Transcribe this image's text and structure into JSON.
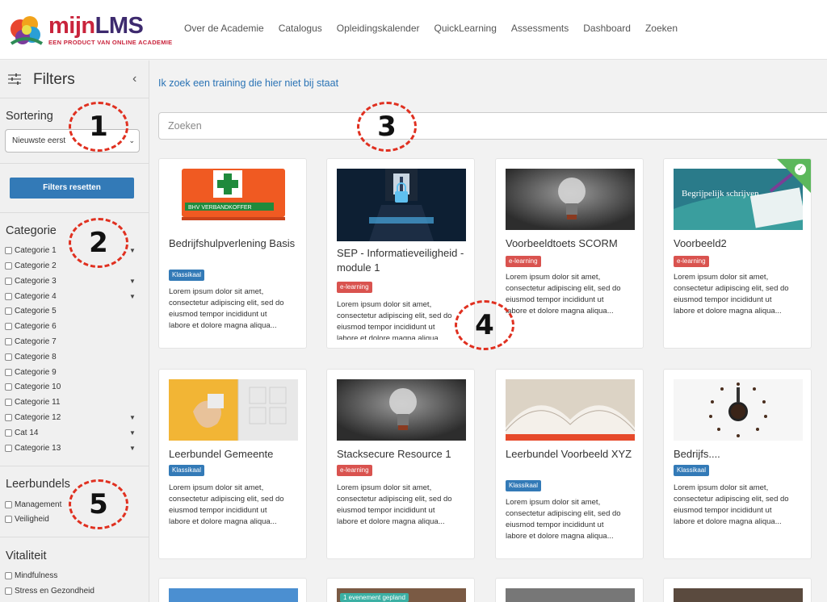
{
  "header": {
    "logo_main_a": "mijn",
    "logo_main_b": "LMS",
    "logo_tagline": "EEN PRODUCT VAN ONLINE ACADEMIE",
    "nav": [
      "Over de Academie",
      "Catalogus",
      "Opleidingskalender",
      "QuickLearning",
      "Assessments",
      "Dashboard",
      "Zoeken"
    ]
  },
  "sidebar": {
    "title": "Filters",
    "sorting_title": "Sortering",
    "sorting_value": "Nieuwste eerst",
    "reset_label": "Filters resetten",
    "category_title": "Categorie",
    "categories": [
      "Categorie 1",
      "Categorie 2",
      "Categorie 3",
      "Categorie 4",
      "Categorie 5",
      "Categorie 6",
      "Categorie 7",
      "Categorie 8",
      "Categorie 9",
      "Categorie 10",
      "Categorie 11",
      "Categorie 12",
      "Cat 14",
      "Categorie 13"
    ],
    "leerbundels_title": "Leerbundels",
    "leerbundels": [
      "Management",
      "Veiligheid"
    ],
    "vitaliteit_title": "Vitaliteit",
    "vitaliteit": [
      "Mindfulness",
      "Stress en Gezondheid"
    ]
  },
  "main": {
    "link": "Ik zoek een training die hier niet bij staat",
    "search_placeholder": "Zoeken",
    "lorem_1": "Lorem ipsum dolor sit amet,",
    "lorem_2": "consectetur adipiscing elit, sed do",
    "lorem_3": "eiusmod tempor incididunt ut",
    "lorem_4": "labore et dolore magna aliqua...",
    "cards": [
      {
        "title": "Bedrijfshulpverlening Basis",
        "badge": "Klassikaal"
      },
      {
        "title": "SEP - Informatieveiligheid - module 1",
        "badge": "e-learning"
      },
      {
        "title": "Voorbeeldtoets SCORM",
        "badge": "e-learning"
      },
      {
        "title": "Voorbeeld2",
        "badge": "e-learning",
        "image_text": "Begrijpelijk schrijven"
      },
      {
        "title": "Leerbundel Gemeente",
        "badge": "Klassikaal"
      },
      {
        "title": "Stacksecure Resource 1",
        "badge": "e-learning"
      },
      {
        "title": "Leerbundel Voorbeeld XYZ",
        "badge": "Klassikaal"
      },
      {
        "title": "Bedrijfs....",
        "badge": "Klassikaal"
      }
    ],
    "event_badge": "1 evenement gepland",
    "first_aid_text": "BHV VERBANDKOFFER"
  },
  "annotations": [
    "1",
    "2",
    "3",
    "4",
    "5"
  ],
  "colors": {
    "primary": "#337ab7",
    "elearning": "#d9534f",
    "accent": "#c9243c",
    "check": "#5cb85c"
  }
}
